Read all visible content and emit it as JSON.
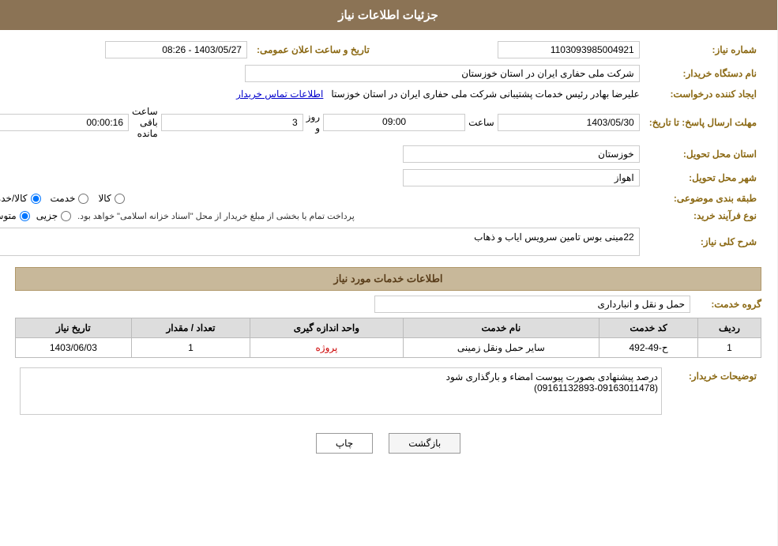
{
  "header": {
    "title": "جزئیات اطلاعات نیاز"
  },
  "fields": {
    "need_number_label": "شماره نیاز:",
    "need_number_value": "1103093985004921",
    "announce_date_label": "تاریخ و ساعت اعلان عمومی:",
    "announce_date_value": "1403/05/27 - 08:26",
    "buyer_org_label": "نام دستگاه خریدار:",
    "buyer_org_value": "شرکت ملی حفاری ایران در استان خوزستان",
    "creator_label": "ایجاد کننده درخواست:",
    "creator_name": "علیرضا بهادر رئیس خدمات پشتیبانی شرکت ملی حفاری ایران در استان خوزستا",
    "creator_link": "اطلاعات تماس خریدار",
    "deadline_label": "مهلت ارسال پاسخ: تا تاریخ:",
    "deadline_date": "1403/05/30",
    "deadline_time_label": "ساعت",
    "deadline_time": "09:00",
    "deadline_days_label": "روز و",
    "deadline_days": "3",
    "deadline_remaining_label": "ساعت باقی مانده",
    "deadline_remaining": "00:00:16",
    "province_label": "استان محل تحویل:",
    "province_value": "خوزستان",
    "city_label": "شهر محل تحویل:",
    "city_value": "اهواز",
    "category_label": "طبقه بندی موضوعی:",
    "category_options": [
      {
        "label": "کالا",
        "selected": false
      },
      {
        "label": "خدمت",
        "selected": false
      },
      {
        "label": "کالا/خدمت",
        "selected": true
      }
    ],
    "purchase_type_label": "نوع فرآیند خرید:",
    "purchase_type_options": [
      {
        "label": "جزیی",
        "selected": false
      },
      {
        "label": "متوسط",
        "selected": true
      }
    ],
    "purchase_type_note": "پرداخت تمام یا بخشی از مبلغ خریدار از محل \"اسناد خزانه اسلامی\" خواهد بود.",
    "need_description_label": "شرح کلی نیاز:",
    "need_description_value": "22مینی بوس تامین سرویس ایاب و ذهاب"
  },
  "services": {
    "section_label": "اطلاعات خدمات مورد نیاز",
    "group_label": "گروه خدمت:",
    "group_value": "حمل و نقل و انبارداری",
    "table_headers": [
      "ردیف",
      "کد خدمت",
      "نام خدمت",
      "واحد اندازه گیری",
      "تعداد / مقدار",
      "تاریخ نیاز"
    ],
    "table_rows": [
      {
        "row": "1",
        "code": "ح-49-492",
        "name": "سایر حمل ونقل زمینی",
        "unit": "پروژه",
        "quantity": "1",
        "date": "1403/06/03"
      }
    ]
  },
  "buyer_notes": {
    "label": "توضیحات خریدار:",
    "value": "درصد پیشنهادی بصورت پیوست امضاء و بارگذاری شود\n(09161132893-09163011478)"
  },
  "buttons": {
    "print": "چاپ",
    "back": "بازگشت"
  }
}
